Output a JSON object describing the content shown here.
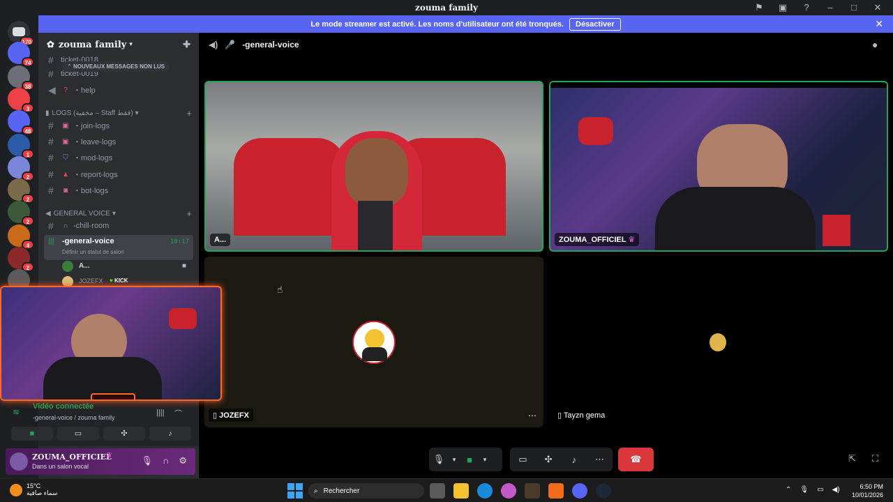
{
  "titlebar": {
    "title": "zouma family"
  },
  "banner": {
    "text": "Le mode streamer est activé. Les noms d'utilisateur ont été tronqués.",
    "button": "Désactiver"
  },
  "servers": [
    {
      "badge": "170"
    },
    {
      "badge": "74"
    },
    {
      "badge": "38"
    },
    {
      "badge": "3"
    },
    {
      "badge": "48"
    },
    {
      "badge": "1"
    },
    {
      "badge": "2"
    },
    {
      "badge": "2"
    },
    {
      "badge": "2"
    },
    {
      "badge": "4"
    },
    {
      "badge": "2"
    },
    {
      "badge": ""
    }
  ],
  "sidebar": {
    "guild_name": "zouma family",
    "unread_pill": "NOUVEAUX MESSAGES NON LUS",
    "channels": [
      {
        "name": "ticket-0018"
      },
      {
        "name": "ticket-0019"
      },
      {
        "name": "・help",
        "emoji": "?"
      },
      {
        "name": "・join-logs"
      },
      {
        "name": "・leave-logs"
      },
      {
        "name": "・mod-logs"
      },
      {
        "name": "・report-logs"
      },
      {
        "name": "・bot-logs"
      },
      {
        "name": "-chill-room"
      }
    ],
    "categories": [
      "LOGS (مخفية – Staff فقط)",
      "GENERAL VOICE"
    ],
    "active_channel": {
      "name": "-general-voice",
      "time": "10:17",
      "status": "Définir un statut de salon"
    },
    "voice_users": [
      {
        "name": "A..."
      },
      {
        "name": "JOZEFX",
        "tag": "KICK"
      }
    ]
  },
  "voice_status": {
    "connected": "Vidéo connectée",
    "channel": "-general-voice / zouma family"
  },
  "user": {
    "name": "ZOUMA_OFFICIEL",
    "status": "Dans un salon vocal"
  },
  "main": {
    "channel": "-general-voice",
    "tiles": [
      {
        "label": "A..."
      },
      {
        "label": "ZOUMA_OFFICIEL"
      },
      {
        "label": "JOZEFX"
      },
      {
        "label": "Tayzn gema"
      }
    ]
  },
  "taskbar": {
    "temp": "15°C",
    "weather": "سماء صافية",
    "search": "Rechercher",
    "time": "6:50 PM",
    "date": "10/01/2026"
  },
  "colors": {
    "accent": "#5865f2",
    "green": "#23a55a",
    "danger": "#da373c"
  }
}
